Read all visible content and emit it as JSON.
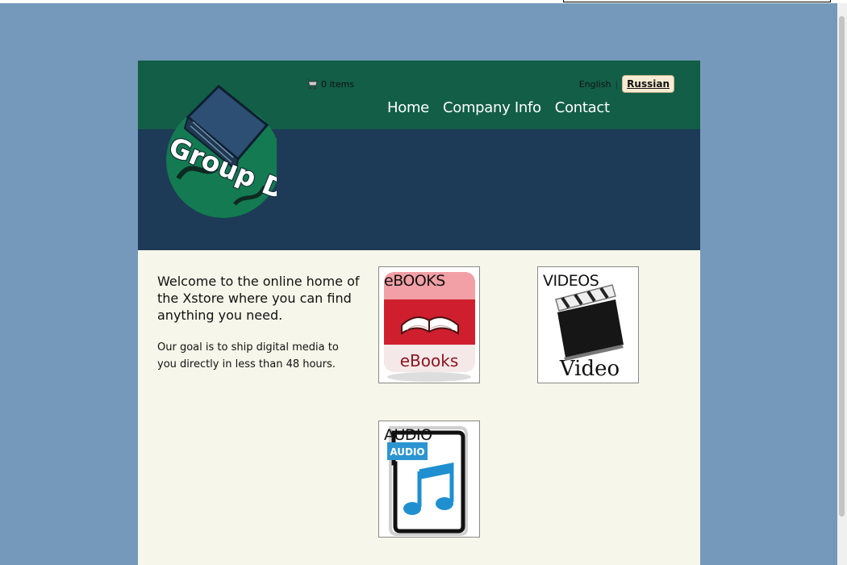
{
  "header": {
    "cart_text": "0 items",
    "lang_english": "English",
    "lang_separator": "|",
    "lang_russian": "Russian"
  },
  "logo": {
    "text": "Group D"
  },
  "nav": {
    "items": [
      "Home",
      "Company Info",
      "Contact"
    ]
  },
  "main": {
    "welcome": "Welcome to the online home of the Xstore where you can find anything you need.",
    "goal": "Our goal is to ship digital media to you directly in less than 48 hours."
  },
  "categories": [
    {
      "title": "eBOOKS",
      "image_text": "eBooks"
    },
    {
      "title": "VIDEOS",
      "image_text": "Video"
    },
    {
      "title": "AUDIO",
      "image_text": "AUDIO"
    }
  ],
  "colors": {
    "background": "#7599ba",
    "header_green": "#125e46",
    "header_navy": "#1d3b56",
    "content_bg": "#f6f6ea"
  }
}
